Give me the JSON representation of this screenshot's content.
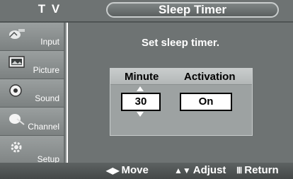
{
  "header": {
    "tv_label": "T V",
    "title": "Sleep Timer"
  },
  "sidebar": {
    "items": [
      {
        "label": "Input",
        "icon": "input-icon"
      },
      {
        "label": "Picture",
        "icon": "picture-icon"
      },
      {
        "label": "Sound",
        "icon": "sound-icon"
      },
      {
        "label": "Channel",
        "icon": "channel-icon"
      },
      {
        "label": "Setup",
        "icon": "setup-icon"
      }
    ]
  },
  "main": {
    "prompt": "Set sleep timer.",
    "columns": {
      "minute": "Minute",
      "activation": "Activation"
    },
    "minute_value": "30",
    "activation_value": "On"
  },
  "footer": {
    "move": "Move",
    "adjust": "Adjust",
    "return": "Return"
  },
  "colors": {
    "panel": "#6e7373",
    "sidebar": "#8c9191",
    "dialog": "#9da2a2"
  }
}
